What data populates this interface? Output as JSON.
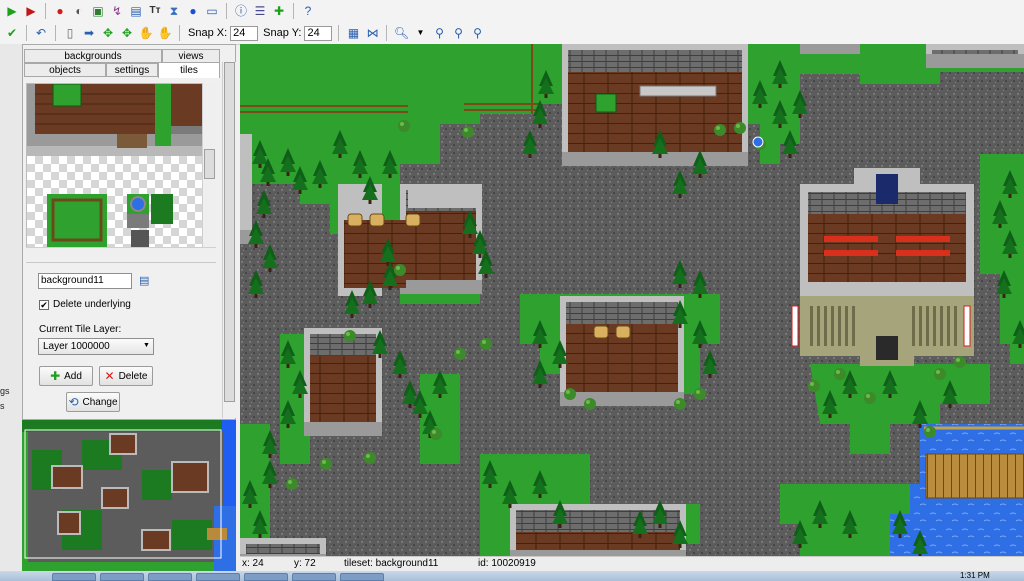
{
  "toolbar": {
    "snap_x_label": "Snap X:",
    "snap_x_value": "24",
    "snap_y_label": "Snap Y:",
    "snap_y_value": "24"
  },
  "panel": {
    "tabs_row1": [
      "backgrounds",
      "views"
    ],
    "tabs_row2": [
      "objects",
      "settings",
      "tiles"
    ],
    "active_tab": "tiles",
    "background_name": "background11",
    "delete_underlying_label": "Delete underlying",
    "delete_underlying_checked": true,
    "current_layer_label": "Current Tile Layer:",
    "current_layer_value": "Layer 1000000",
    "add_label": "Add",
    "delete_label": "Delete",
    "change_label": "Change"
  },
  "leftstrip": {
    "text1": "gs",
    "text2": "s"
  },
  "status": {
    "x": "x: 24",
    "y": "y: 72",
    "tileset": "tileset: background11",
    "id": "id: 10020919"
  },
  "taskbar": {
    "clock": "1:31 PM"
  },
  "colors": {
    "grass": "#2ea12e",
    "dark_grass": "#1c7a20",
    "road": "#5c5c5c",
    "water": "#2f6fe6",
    "wall": "#8a8a8a",
    "floor": "#6a3a22"
  }
}
